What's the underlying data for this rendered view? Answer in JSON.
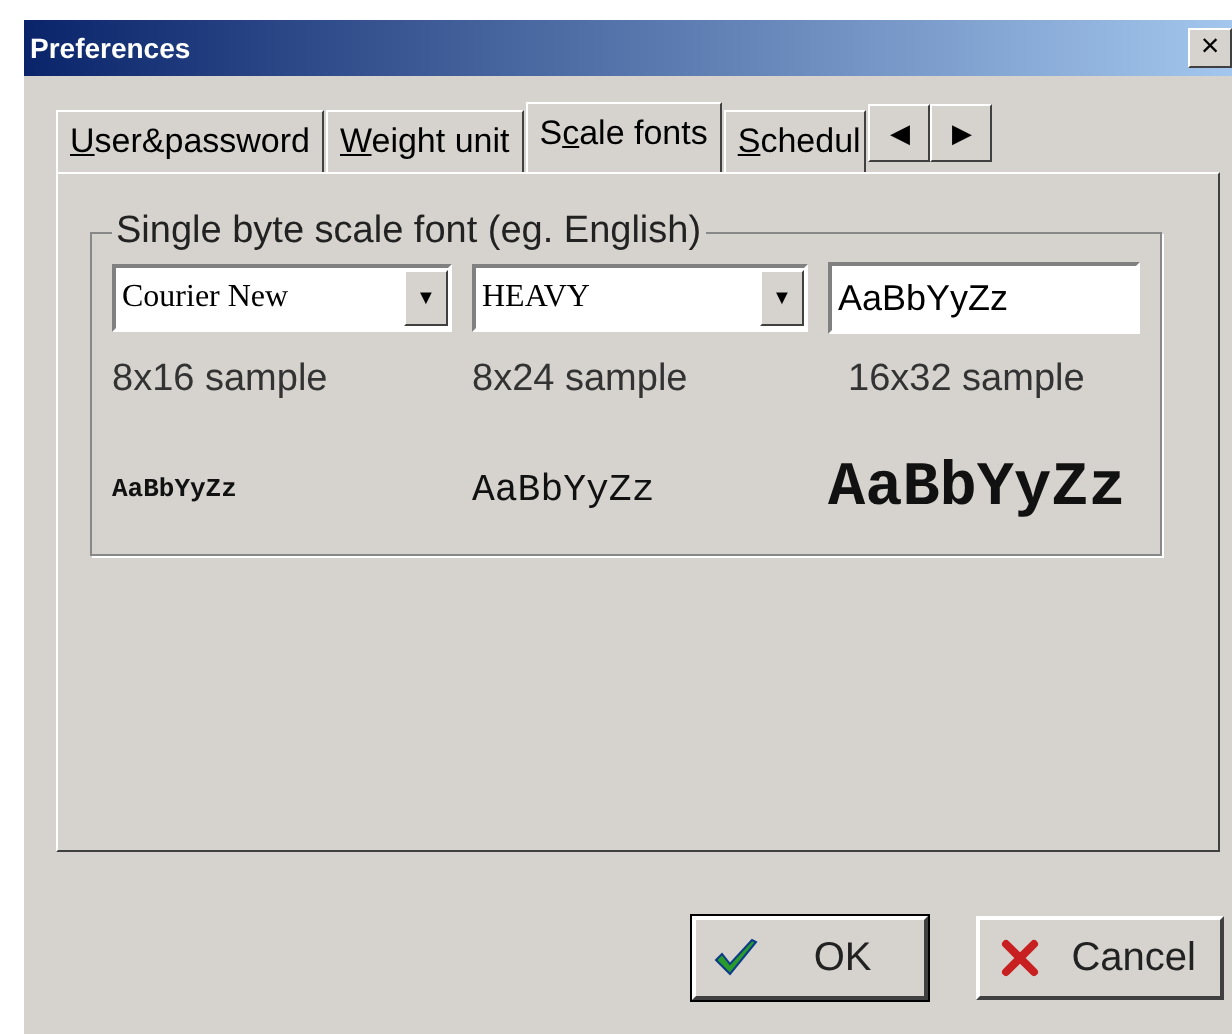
{
  "window": {
    "title": "Preferences",
    "close": "×"
  },
  "tabs": [
    {
      "key": "U",
      "after": "ser&password",
      "selected": false
    },
    {
      "key": "W",
      "after": "eight unit",
      "selected": false
    },
    {
      "before": "S",
      "key": "c",
      "after": "ale fonts",
      "selected": true
    },
    {
      "key": "S",
      "after": "chedul",
      "selected": false
    }
  ],
  "tab_scroll": {
    "left": "◀",
    "right": "▶"
  },
  "group": {
    "title": "Single byte scale font (eg. English)",
    "font_dropdown": {
      "value": "Courier New",
      "arrow": "▼"
    },
    "weight_dropdown": {
      "value": "HEAVY",
      "arrow": "▼"
    },
    "sample_text": {
      "value": "AaBbYyZz"
    },
    "samples": [
      {
        "label": "8x16 sample",
        "preview": "AaBbYyZz",
        "kind": "small"
      },
      {
        "label": "8x24 sample",
        "preview": "AaBbYyZz",
        "kind": "medium"
      },
      {
        "label": "16x32 sample",
        "preview": "AaBbYyZz",
        "kind": "large"
      }
    ]
  },
  "buttons": [
    {
      "label": "OK",
      "kind": "ok",
      "focused": true
    },
    {
      "label": "Cancel",
      "kind": "cancel",
      "focused": false
    }
  ]
}
